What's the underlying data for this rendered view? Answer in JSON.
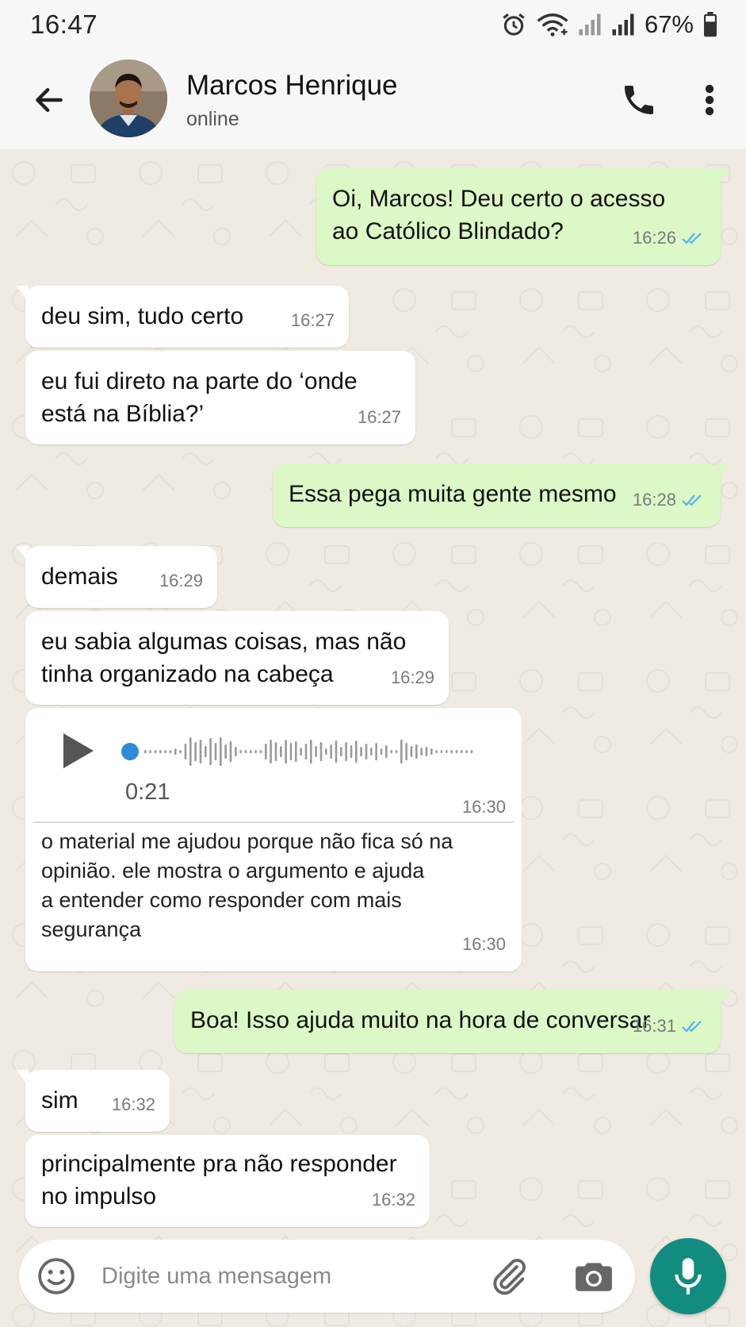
{
  "status_bar": {
    "time": "16:47",
    "battery": "67%"
  },
  "header": {
    "contact_name": "Marcos Henrique",
    "contact_status": "online"
  },
  "messages": [
    {
      "direction": "out",
      "text": "Oi, Marcos! Deu certo o acesso\nao Católico Blindado?",
      "time": "16:26",
      "read": true
    },
    {
      "direction": "in",
      "text": "deu sim, tudo certo",
      "time": "16:27"
    },
    {
      "direction": "in",
      "text": "eu fui direto na parte do ‘onde\nestá na Bíblia?’",
      "time": "16:27"
    },
    {
      "direction": "out",
      "text": "Essa pega muita gente mesmo",
      "time": "16:28",
      "read": true
    },
    {
      "direction": "in",
      "text": "demais",
      "time": "16:29"
    },
    {
      "direction": "in",
      "text": "eu sabia algumas coisas, mas não\ntinha organizado na cabeça",
      "time": "16:29"
    },
    {
      "direction": "in",
      "type": "voice",
      "duration": "0:21",
      "time": "16:30",
      "progress": 0,
      "transcript": "o material me ajudou porque não fica só na\nopinião. ele mostra o argumento e ajuda\na entender como responder com mais\nsegurança",
      "transcript_time": "16:30"
    },
    {
      "direction": "out",
      "text": "Boa! Isso ajuda muito na hora de conversar",
      "time": "16:31",
      "read": true
    },
    {
      "direction": "in",
      "text": "sim",
      "time": "16:32"
    },
    {
      "direction": "in",
      "text": "principalmente pra não responder\nno impulso",
      "time": "16:32"
    }
  ],
  "composer": {
    "placeholder": "Digite uma mensagem"
  },
  "colors": {
    "outgoing_bubble": "#DCF8C6",
    "incoming_bubble": "#FFFFFF",
    "accent": "#128C7E",
    "read_ticks": "#4FB6EC",
    "voice_progress_dot": "#2E8BD8"
  },
  "icons": [
    "back-arrow-icon",
    "phone-icon",
    "more-vert-icon",
    "read-ticks-icon",
    "play-icon",
    "emoji-icon",
    "attach-icon",
    "camera-icon",
    "mic-icon",
    "alarm-icon",
    "wifi-icon",
    "signal-icon",
    "battery-icon"
  ]
}
